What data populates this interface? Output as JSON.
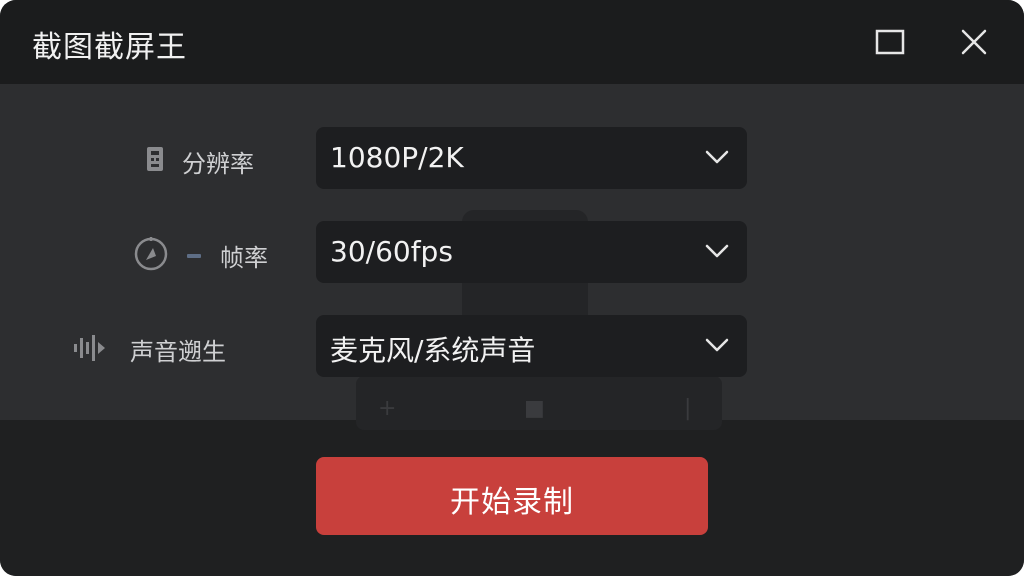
{
  "window": {
    "title": "截图截屏王"
  },
  "settings": {
    "resolution": {
      "label": "分辨率",
      "value": "1080P/2K"
    },
    "framerate": {
      "label": "帧率",
      "value": "30/60fps"
    },
    "audio": {
      "label": "声音遡生",
      "value": "麦克风/系统声音"
    }
  },
  "actions": {
    "start_label": "开始录制"
  },
  "colors": {
    "accent": "#c8403c",
    "background": "#2b2c2e",
    "titlebar": "#1b1c1d"
  },
  "icons": [
    "resolution-icon",
    "timer-icon",
    "waveform-icon",
    "maximize-icon",
    "close-icon",
    "chevron-down-icon"
  ]
}
